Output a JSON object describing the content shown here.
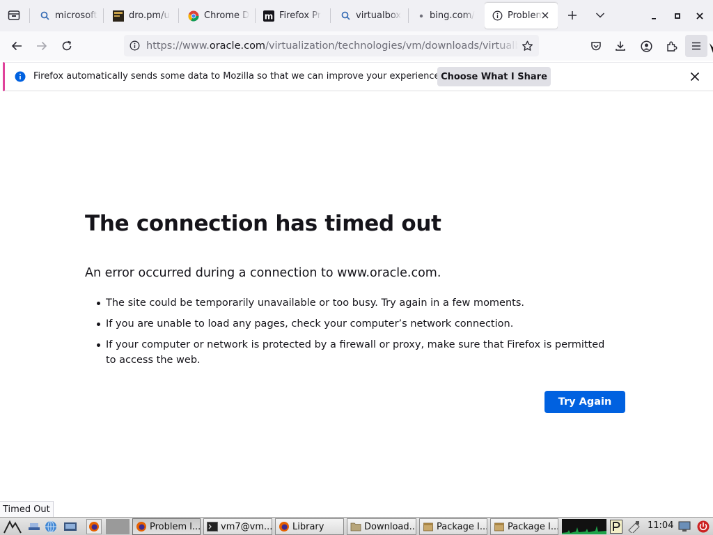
{
  "tabs": [
    {
      "label": "microsoft",
      "icon": "search-icon"
    },
    {
      "label": "dro.pm/u",
      "icon": "dro-favicon-icon"
    },
    {
      "label": "Chrome D",
      "icon": "chrome-icon"
    },
    {
      "label": "Firefox Pr",
      "icon": "m-favicon-icon"
    },
    {
      "label": "virtualbox",
      "icon": "search-icon"
    },
    {
      "label": "bing.com/",
      "icon": "dot-icon"
    },
    {
      "label": "Problem",
      "icon": "info-icon",
      "active": true
    }
  ],
  "url": {
    "prefix": "https://www.",
    "host": "oracle.com",
    "path": "/virtualization/technologies/vm/downloads/virtualbox-do"
  },
  "notification": {
    "message": "Firefox automatically sends some data to Mozilla so that we can improve your experience.",
    "button": "Choose What I Share"
  },
  "error": {
    "title": "The connection has timed out",
    "description": "An error occurred during a connection to www.oracle.com.",
    "bullets": [
      "The site could be temporarily unavailable or too busy. Try again in a few moments.",
      "If you are unable to load any pages, check your computer’s network connection.",
      "If your computer or network is protected by a firewall or proxy, make sure that Firefox is permitted to access the web."
    ],
    "button": "Try Again"
  },
  "status_text": "Timed Out",
  "taskbar": {
    "tasks": [
      {
        "label": "Problem l...",
        "icon": "firefox-icon",
        "active": true
      },
      {
        "label": "vm7@vm...",
        "icon": "terminal-icon"
      },
      {
        "label": "Library",
        "icon": "firefox-icon"
      },
      {
        "label": "Download...",
        "icon": "folder-icon"
      },
      {
        "label": "Package I...",
        "icon": "package-icon"
      },
      {
        "label": "Package I...",
        "icon": "package-icon"
      }
    ],
    "clock": "11:04"
  },
  "colors": {
    "accent": "#0061e0",
    "notification_bar": "#e0429b",
    "info_icon": "#0061e0"
  }
}
